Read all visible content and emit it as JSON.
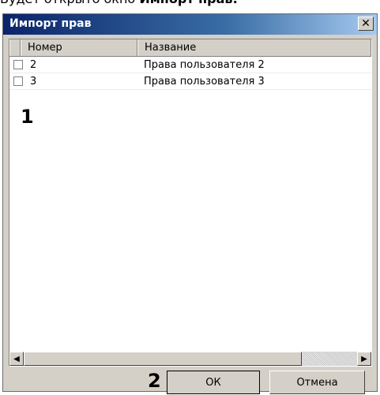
{
  "caption": {
    "prefix": "Будет открыто окно ",
    "bold": "Импорт прав:"
  },
  "dialog": {
    "title": "Импорт прав",
    "close_symbol": "✕",
    "columns": [
      "Номер",
      "Название"
    ],
    "rows": [
      {
        "number": "2",
        "name": "Права пользователя 2",
        "checked": false
      },
      {
        "number": "3",
        "name": "Права пользователя 3",
        "checked": false
      }
    ],
    "annotation_list": "1",
    "annotation_buttons": "2",
    "ok_label": "ОК",
    "cancel_label": "Отмена"
  },
  "icons": {
    "scroll_left": "left-arrow-icon",
    "scroll_right": "right-arrow-icon",
    "close": "close-icon"
  }
}
